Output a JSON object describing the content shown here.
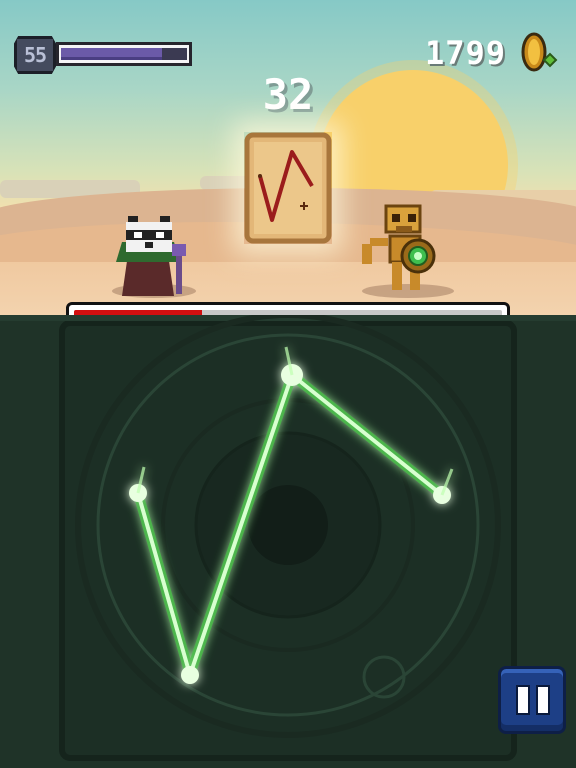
{
  "hud": {
    "hp_number": "55",
    "hp_level": 0.8,
    "coins": "1799",
    "timer": "32"
  },
  "cast_bar": {
    "fill_level": 0.3,
    "fill_color": "#d20f10"
  },
  "colors": {
    "sky": "#a9d6c6",
    "sun": "#f8d06a",
    "sand": "#f0c9a0",
    "panel": "#1f3328",
    "glow_line": "#c8ffc0",
    "glow_outer": "#3fbf3f",
    "pause_button": "#1d3f86",
    "hp_fill": "#6b5aa8"
  },
  "rune_glyph": {
    "name": "rune-card-zigzag",
    "points_normalized": [
      [
        0.15,
        0.4
      ],
      [
        0.35,
        0.8
      ],
      [
        0.6,
        0.25
      ],
      [
        0.85,
        0.55
      ]
    ]
  },
  "icons": {
    "hp": "hp-badge-icon",
    "coin": "gold-coin-icon",
    "pause": "pause-icon"
  },
  "characters": {
    "player": "raccoon-wizard",
    "enemy": "skeleton-warrior"
  }
}
